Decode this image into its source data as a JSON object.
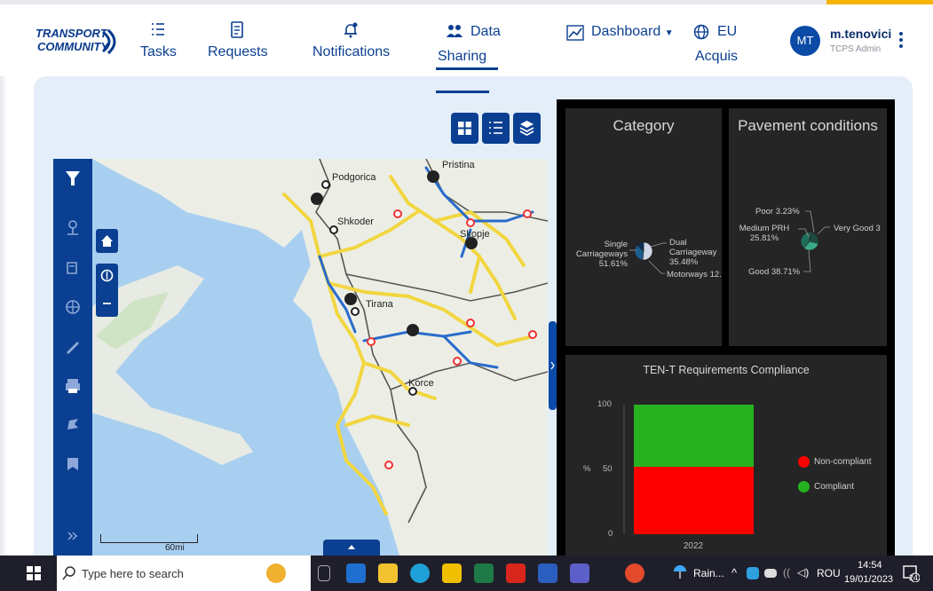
{
  "logo": {
    "line1": "TRANSPORT",
    "line2": "COMMUNITY"
  },
  "nav": {
    "tasks": "Tasks",
    "requests": "Requests",
    "notifications": "Notifications",
    "data": "Data",
    "sharing": "Sharing",
    "dashboard": "Dashboard",
    "eu": "EU",
    "acquis": "Acquis"
  },
  "user": {
    "initials": "MT",
    "name": "m.tenovici",
    "role": "TCPS Admin"
  },
  "map": {
    "places": [
      "Pristina",
      "Podgorica",
      "Shkoder",
      "Skopje",
      "Tirana",
      "Korce"
    ],
    "scale_label": "60mi"
  },
  "dashboard": {
    "category": {
      "title": "Category",
      "labels": {
        "single": [
          "Single",
          "Carriageways",
          "51.61%"
        ],
        "dual": [
          "Dual",
          "Carriageway",
          "35.48%"
        ],
        "motorways": "Motorways 12."
      }
    },
    "pavement": {
      "title": "Pavement conditions",
      "labels": {
        "poor": "Poor 3.23%",
        "medium": [
          "Medium PRH",
          "25.81%"
        ],
        "very_good": "Very Good 3",
        "good": "Good 38.71%"
      }
    },
    "tent": {
      "title": "TEN-T Requirements Compliance",
      "ylabel": "%",
      "ticks": [
        "100",
        "50",
        "0"
      ],
      "legend": [
        "Non-compliant",
        "Compliant"
      ]
    }
  },
  "chart_data": [
    {
      "type": "pie",
      "title": "Category",
      "categories": [
        "Single Carriageways",
        "Dual Carriageway",
        "Motorways"
      ],
      "values": [
        51.61,
        35.48,
        12.9
      ],
      "colors": [
        "#cfd8e6",
        "#1b5e8f",
        "#0c2f57"
      ]
    },
    {
      "type": "pie",
      "title": "Pavement conditions",
      "categories": [
        "Poor",
        "Medium PRH",
        "Very Good",
        "Good"
      ],
      "values": [
        3.23,
        25.81,
        32.25,
        38.71
      ],
      "colors": [
        "#2d8f7a",
        "#1b4d3e",
        "#3aa98a",
        "#1f6e5b"
      ]
    },
    {
      "type": "bar",
      "title": "TEN-T Requirements Compliance",
      "categories": [
        "2022"
      ],
      "series": [
        {
          "name": "Non-compliant",
          "values": [
            52
          ]
        },
        {
          "name": "Compliant",
          "values": [
            48
          ]
        }
      ],
      "stacked": true,
      "ylabel": "%",
      "ylim": [
        0,
        100
      ],
      "colors": [
        "#ff0000",
        "#26b21f"
      ]
    }
  ],
  "taskbar": {
    "search_placeholder": "Type here to search",
    "weather": "Rain...",
    "language": "ROU",
    "time": "14:54",
    "date": "19/01/2023",
    "notif_count": "24"
  }
}
